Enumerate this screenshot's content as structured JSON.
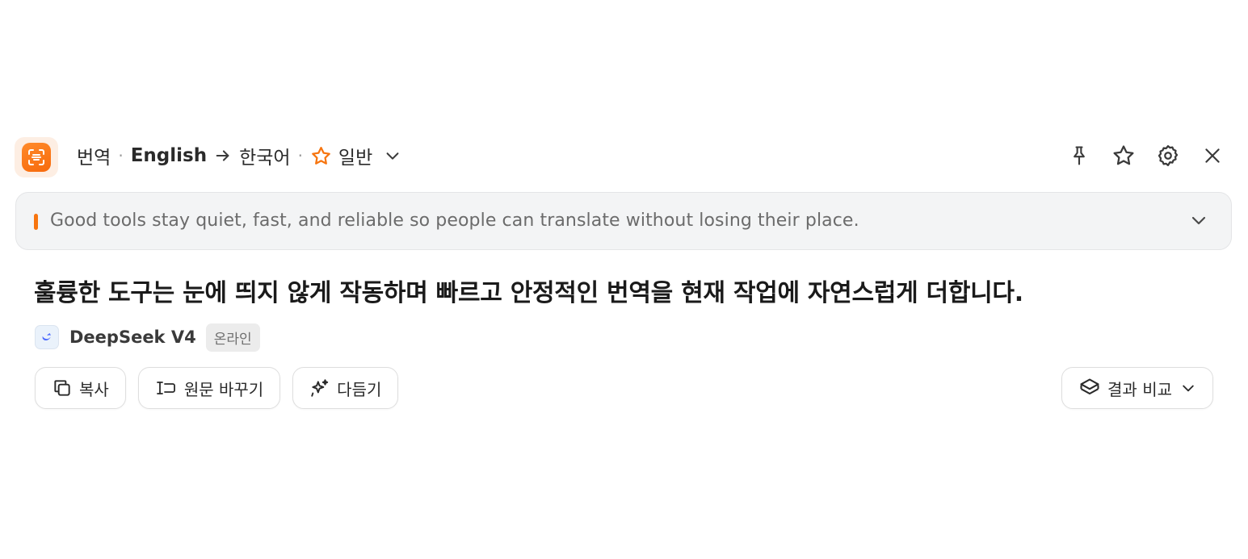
{
  "header": {
    "mode": "번역",
    "source_lang": "English",
    "target_lang": "한국어",
    "preset": "일반",
    "separator": "·"
  },
  "icons": {
    "app": "translate-app-icon",
    "arrow": "arrow-right-icon",
    "preset": "star-outline-icon",
    "preset_dropdown": "chevron-down-icon",
    "pin": "pin-icon",
    "favorite": "star-icon",
    "settings": "gear-icon",
    "close": "close-icon",
    "expand_source": "chevron-down-icon",
    "copy": "copy-icon",
    "replace_source": "replace-icon",
    "polish": "sparkle-icon",
    "compare": "layers-icon"
  },
  "source": {
    "text": "Good tools stay quiet, fast, and reliable so people can translate without losing their place."
  },
  "translation": {
    "text": "훌륭한 도구는 눈에 띄지 않게 작동하며 빠르고 안정적인 번역을 현재 작업에 자연스럽게 더합니다."
  },
  "model": {
    "name": "DeepSeek V4",
    "status": "온라인"
  },
  "actions": {
    "copy_label": "복사",
    "replace_label": "원문 바꾸기",
    "polish_label": "다듬기",
    "compare_label": "결과 비교"
  },
  "colors": {
    "accent": "#f7750f",
    "source_bg": "#f3f4f5",
    "text": "#1f1f1f"
  }
}
